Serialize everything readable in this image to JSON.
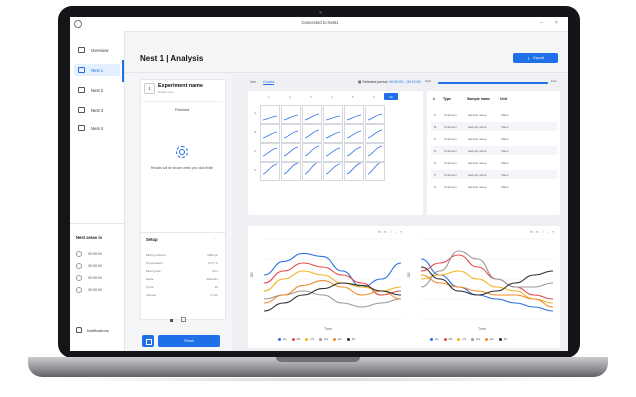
{
  "window": {
    "title": "Connected to Nest1",
    "minimize": "–",
    "close": "×"
  },
  "sidebar": {
    "items": [
      {
        "label": "Overview",
        "active": false
      },
      {
        "label": "Nest 1",
        "active": true
      },
      {
        "label": "Nest 2",
        "active": false
      },
      {
        "label": "Nest 3",
        "active": false
      },
      {
        "label": "Nest 4",
        "active": false
      }
    ],
    "slots_title": "Nest areas in",
    "slots": [
      "00:00:00",
      "00:00:00",
      "00:00:00",
      "00:00:00"
    ],
    "notifications": "Notifications"
  },
  "header": {
    "title": "Nest 1 | Analysis",
    "export_label": "Export"
  },
  "experiment": {
    "number": "1",
    "title": "Experiment name",
    "subtitle": "Details here",
    "status": "Finished",
    "message": "Results will be shown when you click finish"
  },
  "setup": {
    "title": "Setup",
    "rows": [
      {
        "k": "Mixing Volume",
        "v": "1000 μL"
      },
      {
        "k": "Temperature",
        "v": "37.0 °C"
      },
      {
        "k": "Mixing rate",
        "v": "20 s"
      },
      {
        "k": "Mode",
        "v": "Random"
      },
      {
        "k": "Cycle",
        "v": "10"
      },
      {
        "k": "Interval",
        "v": "5 min"
      }
    ],
    "print_label": "",
    "finish_label": "Finish"
  },
  "view": {
    "tabs": [
      "Info",
      "Curves"
    ],
    "active_tab": "Curves",
    "selected_label": "Selected period:",
    "selected_value": "00:00:00 - 00:12:00",
    "slider_start": "Start",
    "slider_end": "End"
  },
  "plate": {
    "cols": [
      "1",
      "2",
      "3",
      "4",
      "5",
      "6"
    ],
    "rows": [
      "A",
      "B",
      "C",
      "D"
    ],
    "button": "All"
  },
  "results_table": {
    "headers": [
      "#",
      "Type",
      "Sample name",
      "Unit"
    ],
    "rows": [
      [
        "A",
        "Unknown",
        "Sample name",
        "Value"
      ],
      [
        "B",
        "Unknown",
        "Sample name",
        "Value"
      ],
      [
        "C",
        "Unknown",
        "Sample name",
        "Value"
      ],
      [
        "D",
        "Unknown",
        "Sample name",
        "Value"
      ],
      [
        "E",
        "Unknown",
        "Sample name",
        "Value"
      ],
      [
        "F",
        "Unknown",
        "Sample name",
        "Value"
      ],
      [
        "G",
        "Unknown",
        "Sample name",
        "Value"
      ]
    ]
  },
  "charts": {
    "x_label": "Time",
    "left_ylabel": "OD",
    "right_ylabel": "OD",
    "toolbar": "⊕ ⊖ ⤢ ⌂ ≡",
    "legend": [
      {
        "name": "A1",
        "color": "#2b6fe0"
      },
      {
        "name": "B2",
        "color": "#e54848"
      },
      {
        "name": "C3",
        "color": "#f2b51d"
      },
      {
        "name": "D1",
        "color": "#999999"
      },
      {
        "name": "E2",
        "color": "#f08a2b"
      },
      {
        "name": "F3",
        "color": "#2d2d2d"
      }
    ]
  },
  "chart_data": [
    {
      "type": "line",
      "x": [
        0,
        1,
        2,
        3,
        4,
        5,
        6,
        7
      ],
      "xlabel": "Time",
      "ylabel": "OD",
      "ylim": [
        0,
        1
      ],
      "series": [
        {
          "name": "A1",
          "values": [
            0.55,
            0.72,
            0.82,
            0.78,
            0.6,
            0.4,
            0.5,
            0.7
          ]
        },
        {
          "name": "B2",
          "values": [
            0.45,
            0.6,
            0.7,
            0.65,
            0.55,
            0.45,
            0.3,
            0.35
          ]
        },
        {
          "name": "C3",
          "values": [
            0.35,
            0.5,
            0.6,
            0.55,
            0.45,
            0.4,
            0.35,
            0.4
          ]
        },
        {
          "name": "D1",
          "values": [
            0.25,
            0.3,
            0.35,
            0.3,
            0.2,
            0.15,
            0.2,
            0.25
          ]
        },
        {
          "name": "E2",
          "values": [
            0.2,
            0.3,
            0.42,
            0.48,
            0.4,
            0.3,
            0.35,
            0.25
          ]
        },
        {
          "name": "F3",
          "values": [
            0.1,
            0.2,
            0.3,
            0.38,
            0.45,
            0.42,
            0.35,
            0.3
          ]
        }
      ]
    },
    {
      "type": "line",
      "x": [
        0,
        1,
        2,
        3,
        4,
        5,
        6,
        7
      ],
      "xlabel": "Time",
      "ylabel": "OD",
      "ylim": [
        0,
        1
      ],
      "series": [
        {
          "name": "A1",
          "values": [
            0.75,
            0.55,
            0.4,
            0.3,
            0.25,
            0.2,
            0.15,
            0.1
          ]
        },
        {
          "name": "B2",
          "values": [
            0.6,
            0.7,
            0.8,
            0.65,
            0.5,
            0.4,
            0.3,
            0.25
          ]
        },
        {
          "name": "C3",
          "values": [
            0.5,
            0.55,
            0.6,
            0.5,
            0.4,
            0.35,
            0.25,
            0.2
          ]
        },
        {
          "name": "D1",
          "values": [
            0.4,
            0.6,
            0.85,
            0.75,
            0.5,
            0.4,
            0.4,
            0.45
          ]
        },
        {
          "name": "E2",
          "values": [
            0.55,
            0.45,
            0.4,
            0.35,
            0.3,
            0.3,
            0.25,
            0.15
          ]
        },
        {
          "name": "F3",
          "values": [
            0.65,
            0.5,
            0.35,
            0.3,
            0.35,
            0.45,
            0.55,
            0.6
          ]
        }
      ]
    }
  ]
}
